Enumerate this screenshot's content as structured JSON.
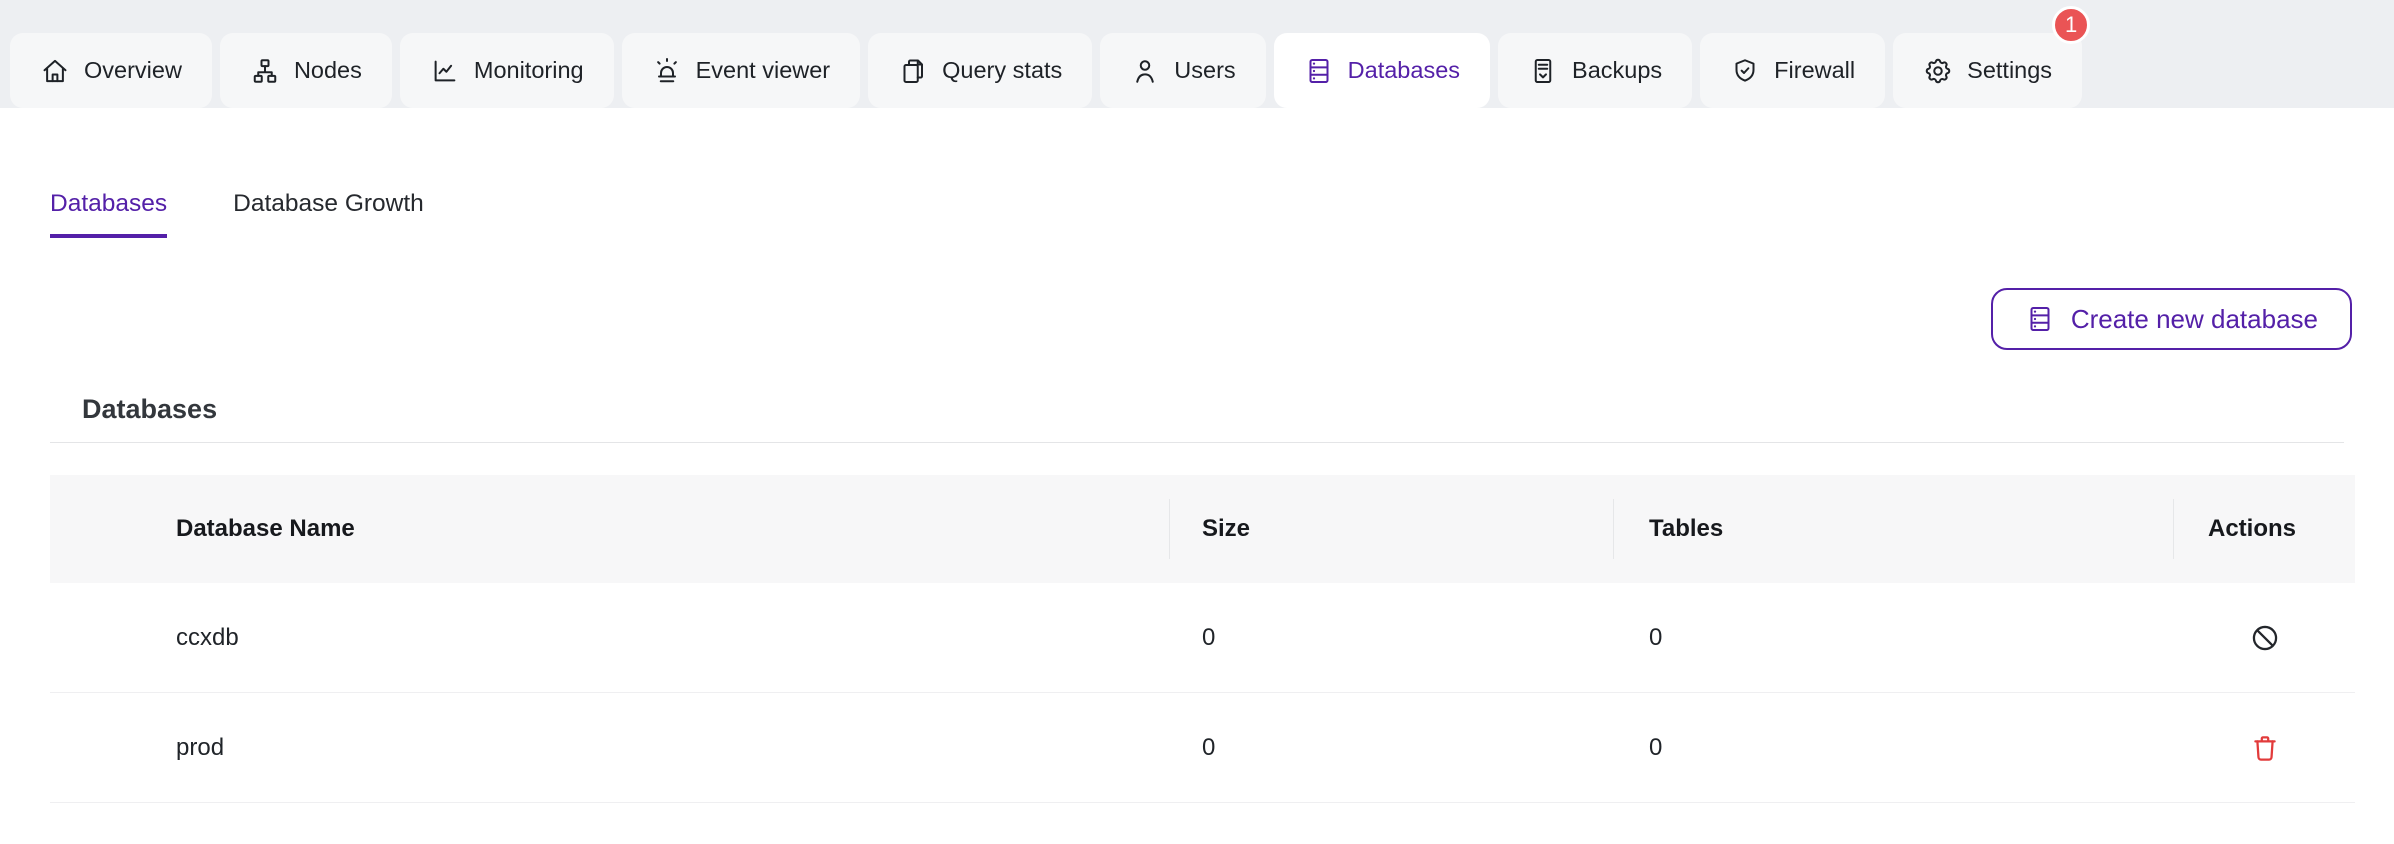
{
  "colors": {
    "accent_purple": "#5420a8",
    "badge_red": "#ea5455",
    "danger_red": "#e23b3b",
    "tabstrip_bg": "#edeff2",
    "inactive_tab_bg": "#f6f7f8",
    "table_header_bg": "#f7f7f8"
  },
  "tab_bar": {
    "tabs": [
      {
        "label": "Overview",
        "icon": "home-icon",
        "active": false
      },
      {
        "label": "Nodes",
        "icon": "nodes-icon",
        "active": false
      },
      {
        "label": "Monitoring",
        "icon": "chart-line-icon",
        "active": false
      },
      {
        "label": "Event viewer",
        "icon": "siren-icon",
        "active": false
      },
      {
        "label": "Query stats",
        "icon": "documents-icon",
        "active": false
      },
      {
        "label": "Users",
        "icon": "user-icon",
        "active": false
      },
      {
        "label": "Databases",
        "icon": "database-icon",
        "active": true
      },
      {
        "label": "Backups",
        "icon": "backup-icon",
        "active": false
      },
      {
        "label": "Firewall",
        "icon": "shield-check-icon",
        "active": false
      },
      {
        "label": "Settings",
        "icon": "gear-icon",
        "active": false,
        "badge": "1"
      }
    ]
  },
  "sub_tabs": [
    {
      "label": "Databases",
      "active": true
    },
    {
      "label": "Database Growth",
      "active": false
    }
  ],
  "toolbar": {
    "create_button_label": "Create new database"
  },
  "section": {
    "title": "Databases"
  },
  "table": {
    "headers": {
      "name": "Database Name",
      "size": "Size",
      "tables": "Tables",
      "actions": "Actions"
    },
    "rows": [
      {
        "name": "ccxdb",
        "size": "0",
        "tables": "0",
        "action_icon": "ban-icon"
      },
      {
        "name": "prod",
        "size": "0",
        "tables": "0",
        "action_icon": "trash-icon"
      }
    ]
  }
}
